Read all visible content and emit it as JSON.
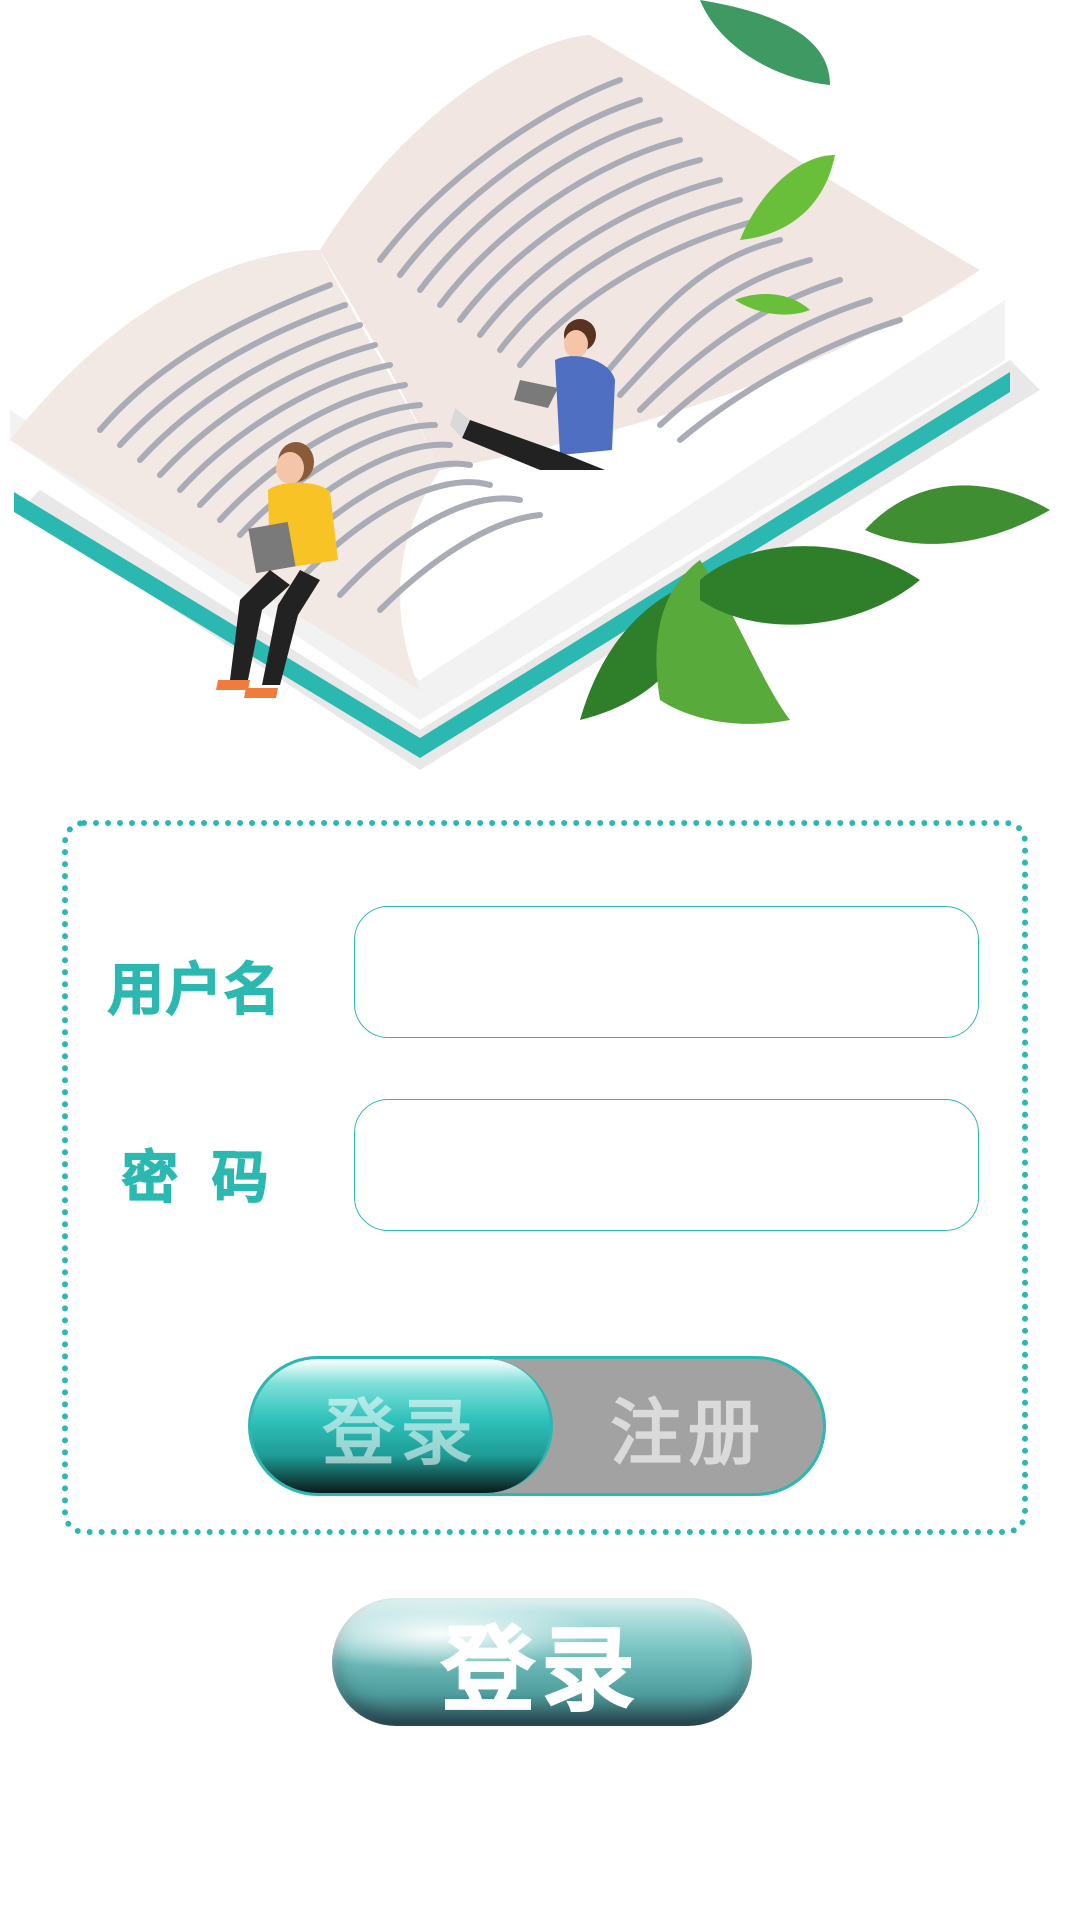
{
  "form": {
    "username_label": "用户名",
    "password_label": "密码",
    "username_value": "",
    "password_value": ""
  },
  "toggle": {
    "login_label": "登录",
    "register_label": "注册",
    "selected": "登录"
  },
  "submit_label": "登录",
  "colors": {
    "accent": "#2bb8b0",
    "toggle_inactive": "#a2a2a2",
    "leaf": "#3a9a3a"
  },
  "illustration": {
    "icons": [
      "open-book",
      "reading-woman",
      "reading-man",
      "leaf"
    ]
  }
}
